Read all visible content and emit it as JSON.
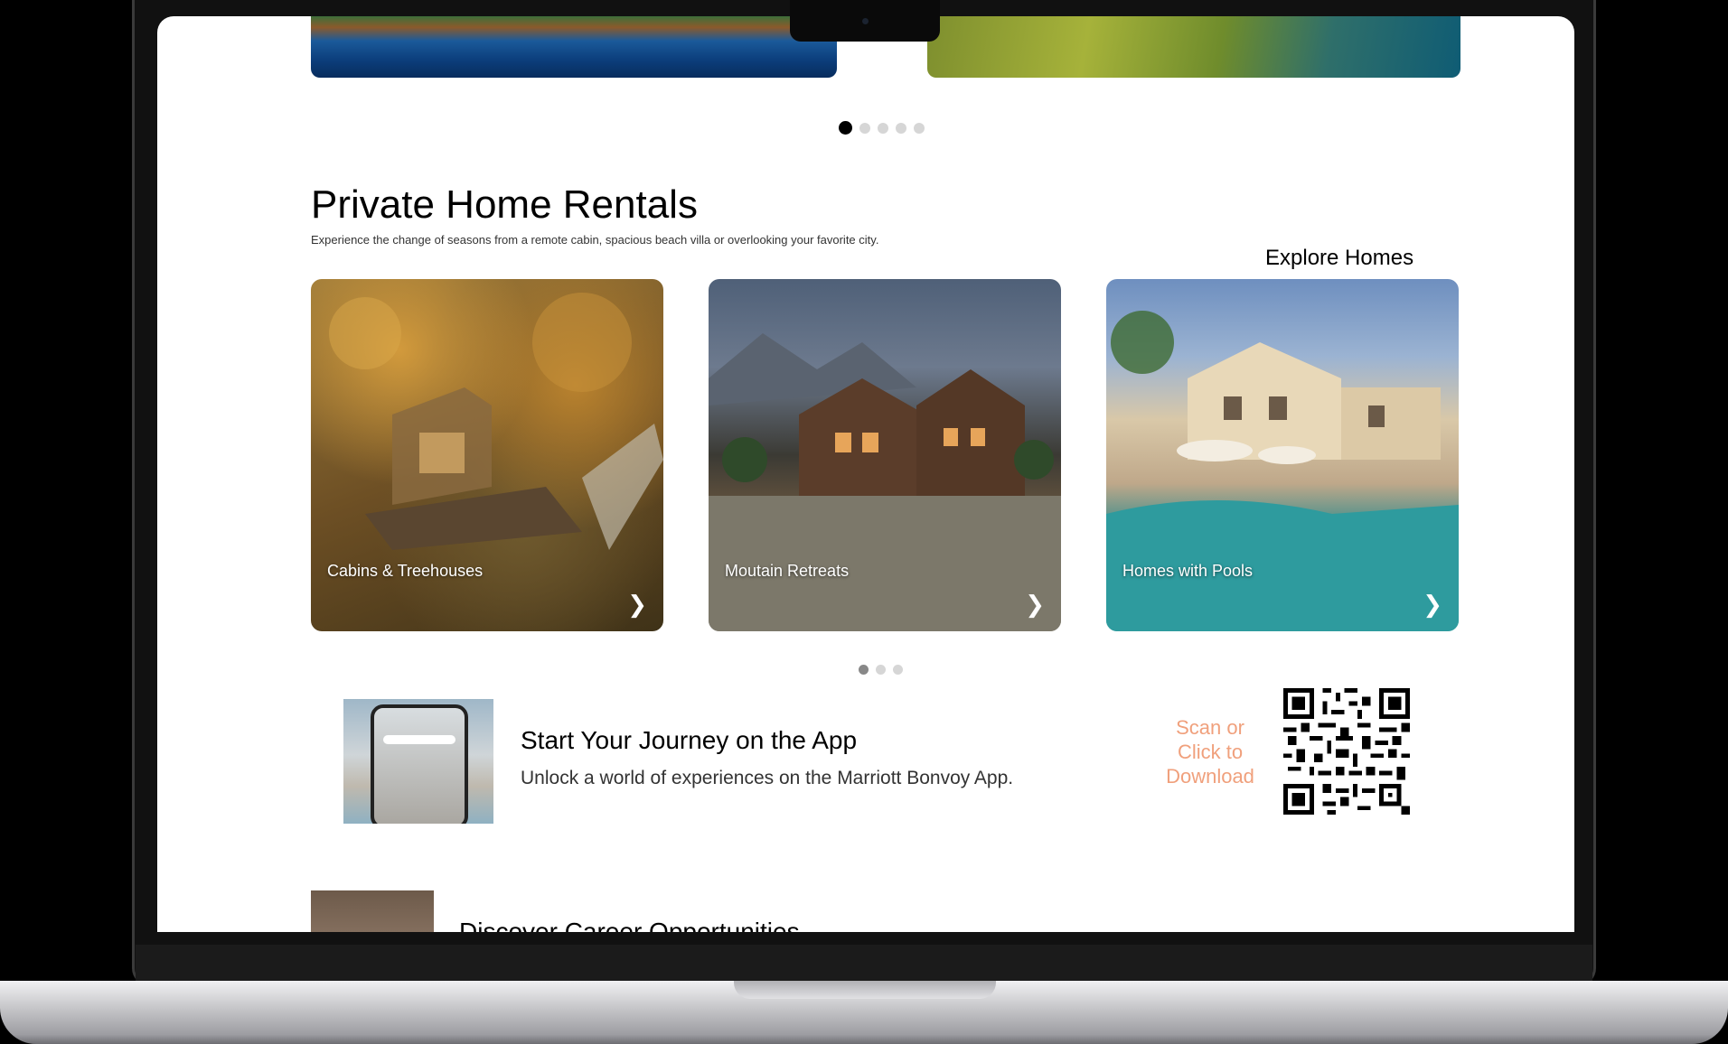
{
  "carousel_top": {
    "active_index": 0,
    "count": 5
  },
  "rentals": {
    "title": "Private Home Rentals",
    "subtitle": "Experience the change of seasons from a remote cabin, spacious beach villa or overlooking your favorite city.",
    "explore_link": "Explore Homes",
    "cards": [
      {
        "label": "Cabins & Treehouses"
      },
      {
        "label": "Moutain Retreats"
      },
      {
        "label": "Homes with Pools"
      }
    ],
    "active_index": 0,
    "page_count": 3
  },
  "app_banner": {
    "title": "Start Your Journey on the App",
    "subtitle": "Unlock a world of experiences on the Marriott Bonvoy App.",
    "scan_text": "Scan or Click to Download",
    "accent_color": "#f0a07c"
  },
  "career": {
    "title": "Discover Career Opportunities"
  },
  "icons": {
    "chevron": "chevron-right-icon",
    "qr": "qr-code-icon"
  }
}
